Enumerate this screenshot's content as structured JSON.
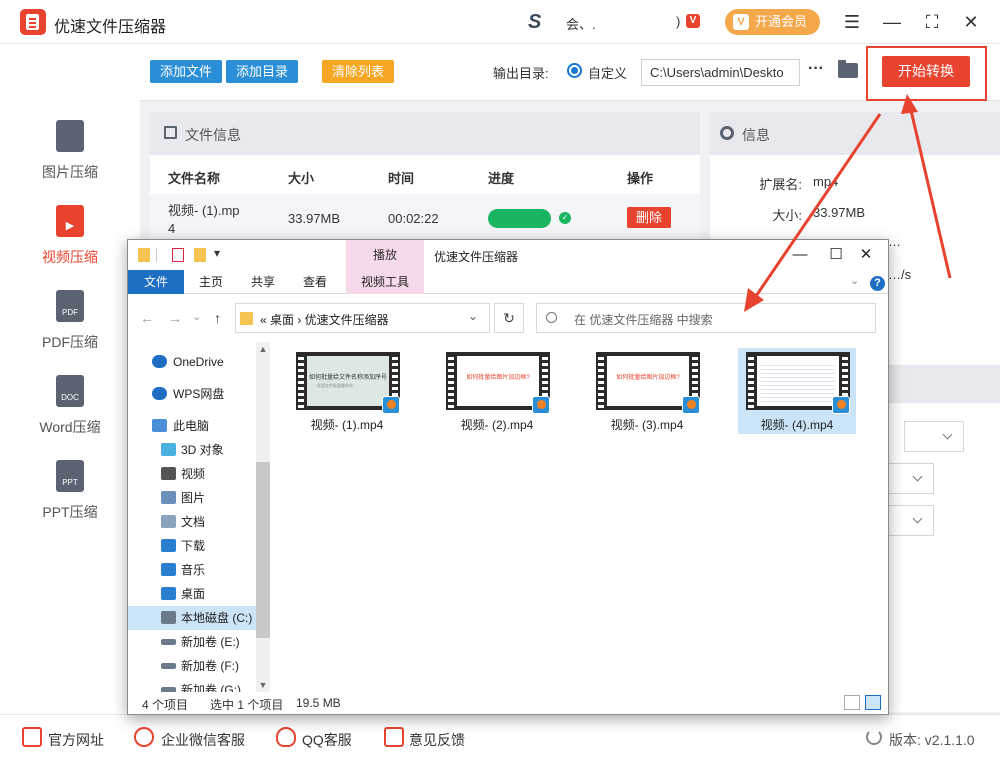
{
  "app": {
    "title": "优速文件压缩器",
    "user_name": "会、.",
    "user_suffix": ")",
    "vip_badge": "V",
    "vip_label": "开通会员",
    "vip_icon": "V",
    "menu_glyph": "☰",
    "min_glyph": "—",
    "max_glyph": "⛶",
    "close_glyph": "✕"
  },
  "sidebar": {
    "items": [
      {
        "label": "图片压缩",
        "icon": "image-file-icon",
        "badge": "",
        "active": false
      },
      {
        "label": "视频压缩",
        "icon": "video-file-icon",
        "badge": "▶",
        "active": true
      },
      {
        "label": "PDF压缩",
        "icon": "pdf-file-icon",
        "badge": "PDF",
        "active": false
      },
      {
        "label": "Word压缩",
        "icon": "doc-file-icon",
        "badge": "DOC",
        "active": false
      },
      {
        "label": "PPT压缩",
        "icon": "ppt-file-icon",
        "badge": "PPT",
        "active": false
      }
    ]
  },
  "toolbar": {
    "add_file": "添加文件",
    "add_dir": "添加目录",
    "clear_list": "清除列表",
    "output_label": "输出目录:",
    "radio_label": "自定义",
    "output_path": "C:\\Users\\admin\\Deskto",
    "more": "···",
    "start": "开始转换"
  },
  "file_panel": {
    "title": "文件信息",
    "columns": [
      "文件名称",
      "大小",
      "时间",
      "进度",
      "操作"
    ],
    "rows": [
      {
        "name_line1": "视频- (1).mp",
        "name_line2": "4",
        "size": "33.97MB",
        "time": "00:02:22",
        "progress": 1.0,
        "status_glyph": "✓",
        "action": "删除"
      }
    ]
  },
  "info_panel": {
    "title": "信息",
    "ext_label": "扩展名:",
    "ext_value": "mp4",
    "size_label": "大小:",
    "size_value": "33.97MB",
    "partial_row1": "…",
    "partial_row2": "…/s"
  },
  "bottom": {
    "links": [
      "官方网址",
      "企业微信客服",
      "QQ客服",
      "意见反馈"
    ],
    "version": "版本: v2.1.1.0"
  },
  "explorer": {
    "ribbon_context": "播放",
    "window_title": "优速文件压缩器",
    "tab_file": "文件",
    "tabs": [
      "主页",
      "共享",
      "查看"
    ],
    "tab_video": "视频工具",
    "min_glyph": "—",
    "max_glyph": "☐",
    "close_glyph": "✕",
    "qa_dropdown": "▾",
    "address_text": "«  桌面  ›  优速文件压缩器",
    "address_dropdown": "⌄",
    "refresh_glyph": "↻",
    "search_placeholder": "在 优速文件压缩器 中搜索",
    "nav_back": "←",
    "nav_forward": "→",
    "nav_recent": "⌄",
    "nav_up": "↑",
    "help_glyph": "?",
    "collapse_glyph": "⌄",
    "nav_items": [
      {
        "label": "OneDrive",
        "icon": "onedrive-icon",
        "color": "#1e6fc4",
        "indent": 0,
        "selected": false
      },
      {
        "label": "WPS网盘",
        "icon": "wps-cloud-icon",
        "color": "#1e6fc4",
        "indent": 0,
        "selected": false
      },
      {
        "label": "此电脑",
        "icon": "this-pc-icon",
        "color": "#4a8fd8",
        "indent": 0,
        "selected": false
      },
      {
        "label": "3D 对象",
        "icon": "3d-objects-icon",
        "color": "#4ab0e0",
        "indent": 1,
        "selected": false
      },
      {
        "label": "视频",
        "icon": "videos-folder-icon",
        "color": "#555",
        "indent": 1,
        "selected": false
      },
      {
        "label": "图片",
        "icon": "pictures-folder-icon",
        "color": "#6a8fb8",
        "indent": 1,
        "selected": false
      },
      {
        "label": "文档",
        "icon": "documents-folder-icon",
        "color": "#8aa4c0",
        "indent": 1,
        "selected": false
      },
      {
        "label": "下载",
        "icon": "downloads-folder-icon",
        "color": "#2b7fd0",
        "indent": 1,
        "selected": false
      },
      {
        "label": "音乐",
        "icon": "music-folder-icon",
        "color": "#2b7fd0",
        "indent": 1,
        "selected": false
      },
      {
        "label": "桌面",
        "icon": "desktop-folder-icon",
        "color": "#2b7fd0",
        "indent": 1,
        "selected": false
      },
      {
        "label": "本地磁盘 (C:)",
        "icon": "local-disk-icon",
        "color": "#6a7a8a",
        "indent": 1,
        "selected": true
      },
      {
        "label": "新加卷 (E:)",
        "icon": "drive-e-icon",
        "color": "#6a7a8a",
        "indent": 1,
        "selected": false
      },
      {
        "label": "新加卷 (F:)",
        "icon": "drive-f-icon",
        "color": "#6a7a8a",
        "indent": 1,
        "selected": false
      },
      {
        "label": "新加卷 (G:)",
        "icon": "drive-g-icon",
        "color": "#6a7a8a",
        "indent": 1,
        "selected": false
      }
    ],
    "files": [
      {
        "name": "视频- (1).mp4",
        "thumb_text": "如何批量给文件名称添加序号",
        "thumb_sub": "优速文件批量重命名",
        "style": "slide1",
        "selected": false
      },
      {
        "name": "视频- (2).mp4",
        "thumb_text": "如何批量给图片加边框?",
        "thumb_sub": "",
        "style": "slide2",
        "selected": false
      },
      {
        "name": "视频- (3).mp4",
        "thumb_text": "如何批量给图片加边框?",
        "thumb_sub": "",
        "style": "slide2",
        "selected": false
      },
      {
        "name": "视频- (4).mp4",
        "thumb_text": "",
        "thumb_sub": "",
        "style": "slide3",
        "selected": true
      }
    ],
    "status_count": "4 个项目",
    "status_selected": "选中 1 个项目",
    "status_size": "19.5 MB",
    "scroll_up": "▲",
    "scroll_down": "▼"
  },
  "colors": {
    "accent": "#e8432f",
    "blue_button": "#2b8fd8",
    "clear_button": "#f5a623",
    "progress": "#19b560",
    "explorer_blue": "#1e6fc4"
  }
}
